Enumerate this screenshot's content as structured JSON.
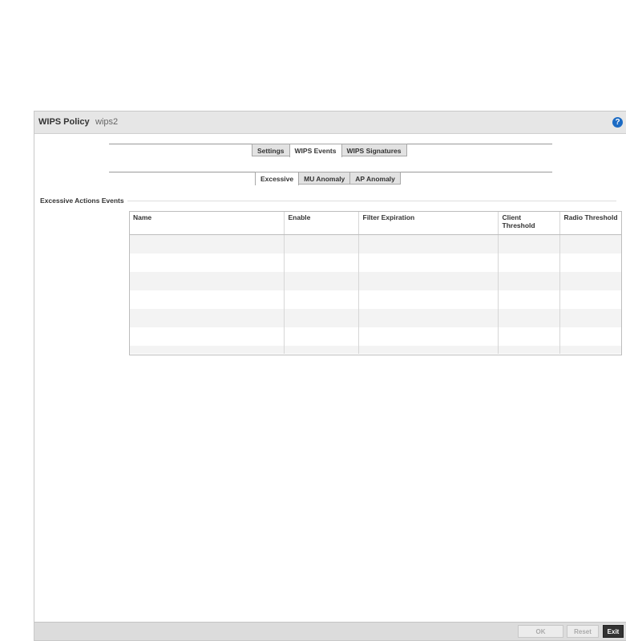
{
  "header": {
    "title": "WIPS Policy",
    "subtitle": "wips2"
  },
  "help_icon": "?",
  "tabs": [
    {
      "label": "Settings",
      "active": false
    },
    {
      "label": "WIPS Events",
      "active": true
    },
    {
      "label": "WIPS Signatures",
      "active": false
    }
  ],
  "subtabs": [
    {
      "label": "Excessive",
      "active": true
    },
    {
      "label": "MU Anomaly",
      "active": false
    },
    {
      "label": "AP Anomaly",
      "active": false
    }
  ],
  "section": {
    "label": "Excessive Actions Events"
  },
  "table": {
    "columns": [
      "Name",
      "Enable",
      "Filter Expiration",
      "Client Threshold",
      "Radio Threshold"
    ],
    "rows": []
  },
  "footer": {
    "ok": "OK",
    "reset": "Reset",
    "exit": "Exit"
  }
}
